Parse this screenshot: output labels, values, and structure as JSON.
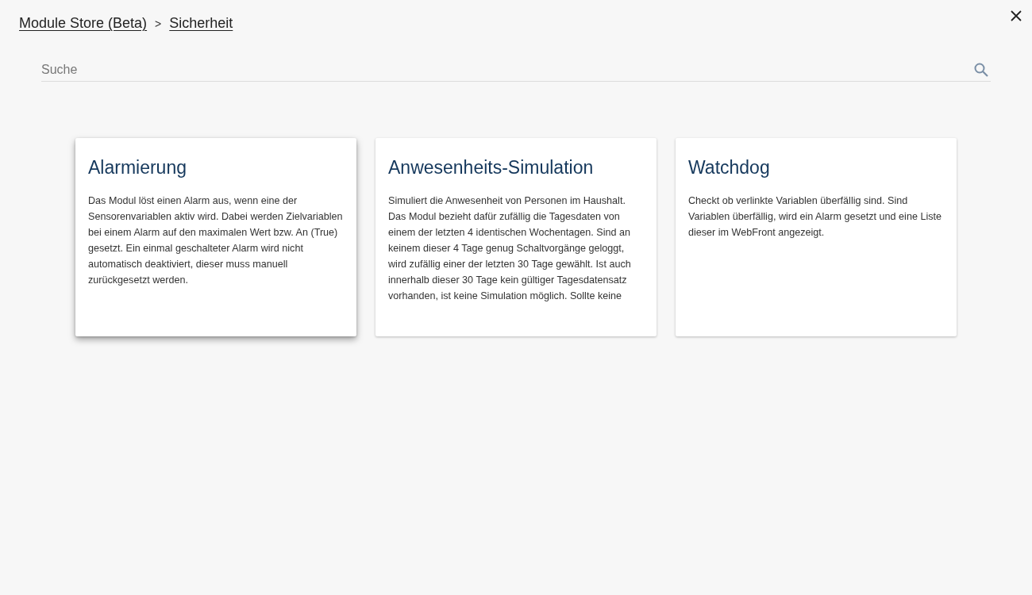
{
  "breadcrumb": {
    "items": [
      {
        "label": "Module Store (Beta)"
      },
      {
        "label": "Sicherheit"
      }
    ],
    "separator": ">"
  },
  "search": {
    "placeholder": "Suche"
  },
  "cards": [
    {
      "title": "Alarmierung",
      "description": "Das Modul löst einen Alarm aus, wenn eine der Sensorenvariablen aktiv wird. Dabei werden Zielvariablen bei einem Alarm auf den maximalen Wert bzw. An (True) gesetzt. Ein einmal geschalteter Alarm wird nicht automatisch deaktiviert, dieser muss manuell zurückgesetzt werden.",
      "hovered": true
    },
    {
      "title": "Anwesenheits-Simulation",
      "description": "Simuliert die Anwesenheit von Personen im Haushalt. Das Modul bezieht dafür zufällig die Tagesdaten von einem der letzten 4 identischen Wochentagen. Sind an keinem dieser 4 Tage genug Schaltvorgänge geloggt, wird zufällig einer der letzten 30 Tage gewählt. Ist auch innerhalb dieser 30 Tage kein gültiger Tagesdatensatz vorhanden, ist keine Simulation möglich. Sollte keine",
      "hovered": false
    },
    {
      "title": "Watchdog",
      "description": "Checkt ob verlinkte Variablen überfällig sind. Sind Variablen überfällig, wird ein Alarm gesetzt und eine Liste dieser im WebFront angezeigt.",
      "hovered": false
    }
  ]
}
